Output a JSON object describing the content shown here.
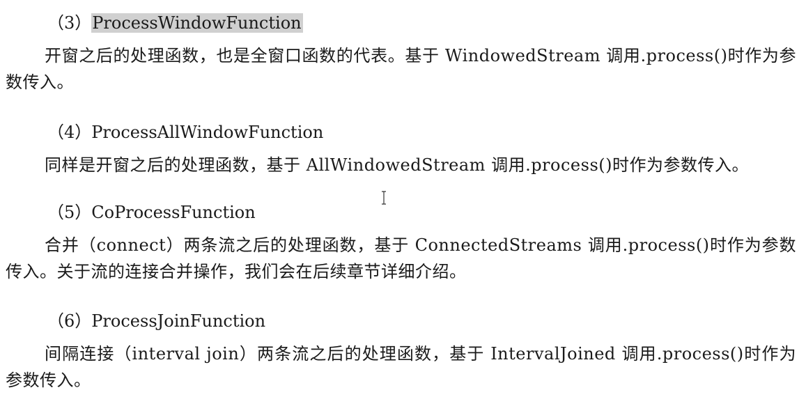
{
  "sections": [
    {
      "number": "（3）",
      "title": "ProcessWindowFunction",
      "body": "开窗之后的处理函数，也是全窗口函数的代表。基于 WindowedStream 调用.process()时作为参数传入。"
    },
    {
      "number": "（4）",
      "title": "ProcessAllWindowFunction",
      "body": "同样是开窗之后的处理函数，基于 AllWindowedStream 调用.process()时作为参数传入。"
    },
    {
      "number": "（5）",
      "title": "CoProcessFunction",
      "body": "合并（connect）两条流之后的处理函数，基于 ConnectedStreams 调用.process()时作为参数传入。关于流的连接合并操作，我们会在后续章节详细介绍。"
    },
    {
      "number": "（6）",
      "title": "ProcessJoinFunction",
      "body": "间隔连接（interval join）两条流之后的处理函数，基于 IntervalJoined 调用.process()时作为参数传入。"
    }
  ],
  "colors": {
    "text": "#1a1a1a",
    "highlight": "#d0d0d0"
  },
  "cursor_icon": "text-cursor-icon"
}
